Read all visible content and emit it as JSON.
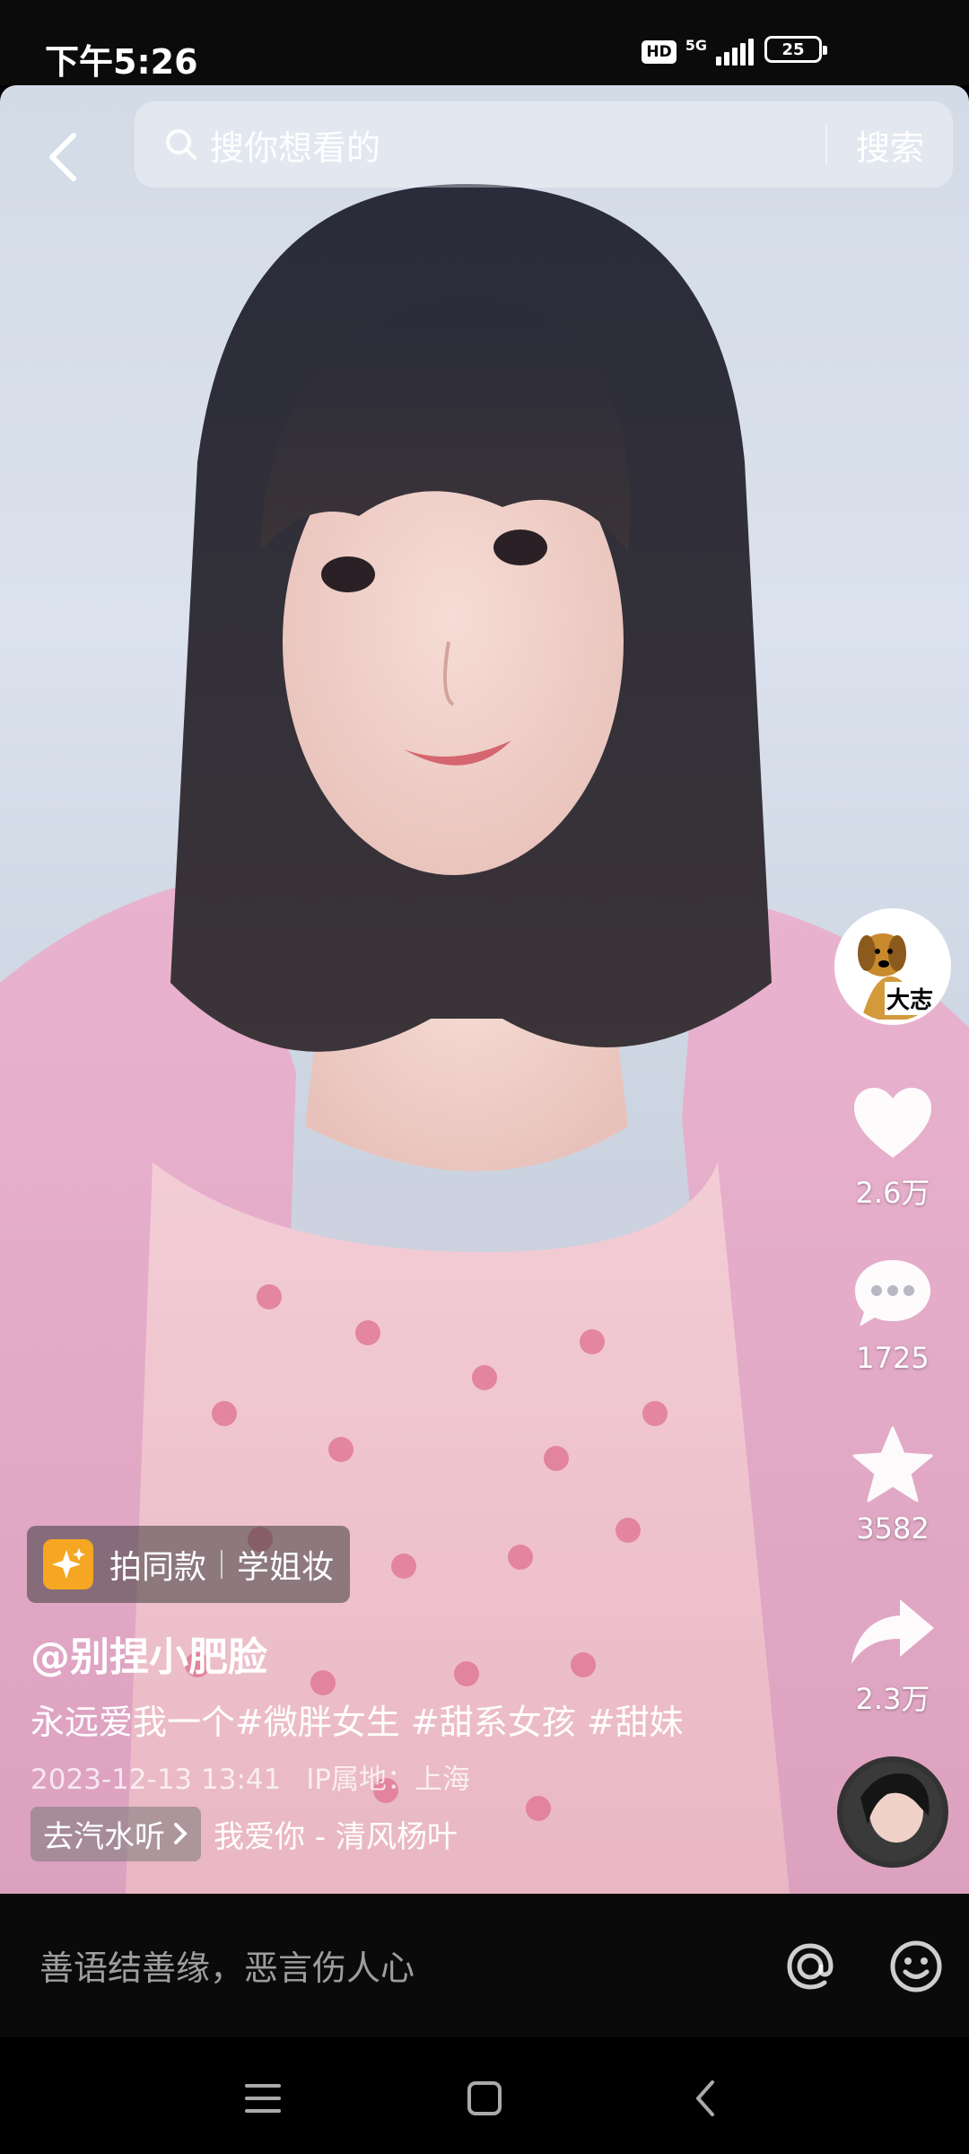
{
  "status_bar": {
    "time": "下午5:26",
    "hd_badge": "HD",
    "network": "5G",
    "battery": "25"
  },
  "search": {
    "placeholder": "搜你想看的",
    "button_label": "搜索"
  },
  "rail": {
    "avatar_text": "大志",
    "likes": "2.6万",
    "comments": "1725",
    "favorites": "3582",
    "shares": "2.3万"
  },
  "template_chip": {
    "action": "拍同款",
    "tag": "学姐妆"
  },
  "post": {
    "author": "@别捏小肥脸",
    "caption": "永远爱我一个#微胖女生 #甜系女孩 #甜妹",
    "timestamp": "2023-12-13 13:41",
    "ip_location": "IP属地：上海"
  },
  "music": {
    "action": "去汽水听",
    "title": "我爱你 - 清风杨叶"
  },
  "comment_bar": {
    "placeholder": "善语结善缘，恶言伤人心"
  },
  "colors": {
    "accent_sparkle": "#f5a623",
    "background": "#000000"
  }
}
